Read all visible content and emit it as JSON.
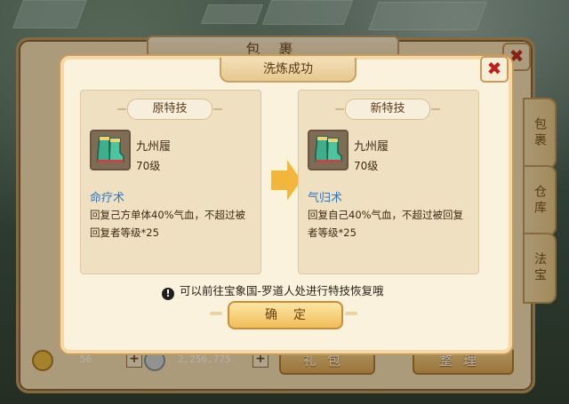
{
  "bag": {
    "title": "包 裹",
    "close_label": "✖",
    "tabs": [
      "包裹",
      "仓库",
      "法宝"
    ],
    "coin_amount": "56",
    "silver_amount": "2,256,775",
    "gift_button": "礼包",
    "sort_button": "整理"
  },
  "dialog": {
    "title": "洗炼成功",
    "close_label": "✖",
    "hint": "可以前往宝象国-罗道人处进行特技恢复哦",
    "confirm_button": "确定",
    "old": {
      "header": "原特技",
      "item_name": "九州履",
      "item_level": "70级",
      "skill_name": "命疗术",
      "skill_desc": "回复己方单体40%气血，不超过被回复者等级*25"
    },
    "new": {
      "header": "新特技",
      "item_name": "九州履",
      "item_level": "70级",
      "skill_name": "气归术",
      "skill_desc": "回复自己40%气血，不超过被回复者等级*25"
    }
  },
  "colors": {
    "skill_name": "#2f77c8",
    "close_x": "#c11e1e",
    "arrow": "#f0b43a"
  }
}
